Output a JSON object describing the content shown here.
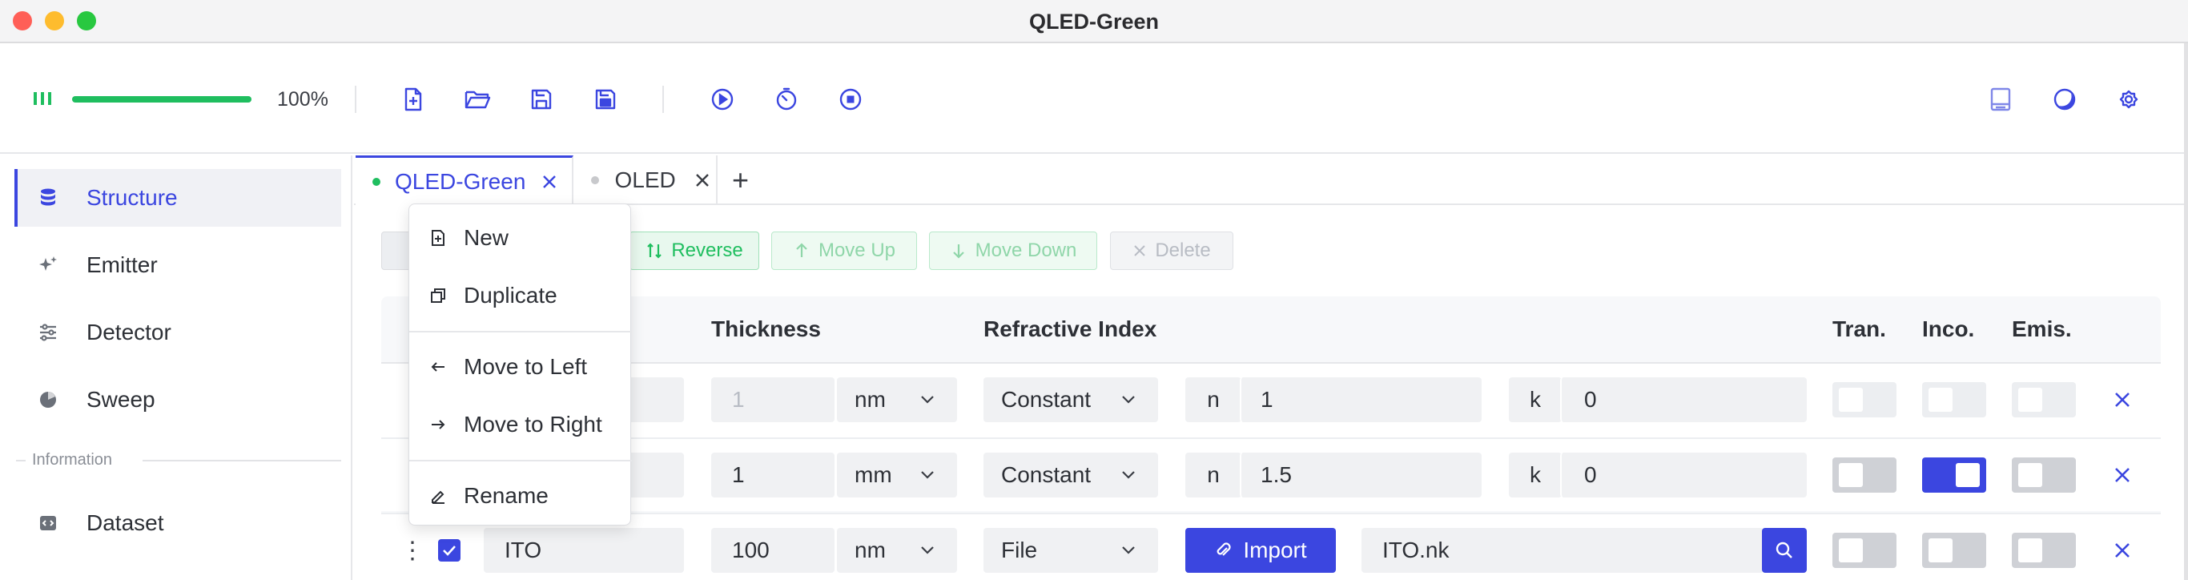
{
  "window": {
    "title": "QLED-Green",
    "traffic_colors": [
      "#ff5f57",
      "#febc2e",
      "#28c840"
    ]
  },
  "toolbar": {
    "progress": 1.0,
    "progress_label": "100%",
    "accent": "#3b46e0",
    "progress_color": "#1fbe5f",
    "icons": [
      "new-file-icon",
      "open-folder-icon",
      "save-icon",
      "save-as-icon",
      "run-icon",
      "timer-icon",
      "stop-icon",
      "book-icon",
      "theme-icon",
      "settings-icon"
    ]
  },
  "sidebar": {
    "items": [
      {
        "label": "Structure",
        "icon": "database-icon",
        "active": true
      },
      {
        "label": "Emitter",
        "icon": "sparkle-icon",
        "active": false
      },
      {
        "label": "Detector",
        "icon": "sliders-icon",
        "active": false
      },
      {
        "label": "Sweep",
        "icon": "sweep-icon",
        "active": false
      }
    ],
    "section_label": "Information",
    "info_items": [
      {
        "label": "Dataset",
        "icon": "code-file-icon"
      }
    ]
  },
  "tabs": {
    "items": [
      {
        "label": "QLED-Green",
        "active": true,
        "status_color": "#1fbe5f"
      },
      {
        "label": "OLED",
        "active": false,
        "status_color": "#c8c9cc"
      }
    ],
    "add_label": "+"
  },
  "actions": {
    "reverse": "Reverse",
    "move_up": "Move Up",
    "move_down": "Move Down",
    "delete": "Delete"
  },
  "table": {
    "headers": {
      "thickness": "Thickness",
      "refractive_index": "Refractive Index",
      "tran": "Tran.",
      "inco": "Inco.",
      "emis": "Emis."
    },
    "rows": [
      {
        "name": "",
        "thickness": "1",
        "unit": "nm",
        "ri_type": "Constant",
        "n_label": "n",
        "n": "1",
        "k_label": "k",
        "k": "0",
        "tran": false,
        "inco": false,
        "emis": false,
        "disabled": true
      },
      {
        "name": "",
        "thickness": "1",
        "unit": "mm",
        "ri_type": "Constant",
        "n_label": "n",
        "n": "1.5",
        "k_label": "k",
        "k": "0",
        "tran": false,
        "inco": true,
        "emis": false,
        "disabled": false
      },
      {
        "name": "ITO",
        "thickness": "100",
        "unit": "nm",
        "ri_type": "File",
        "import_label": "Import",
        "file": "ITO.nk",
        "tran": false,
        "inco": false,
        "emis": false,
        "checked": true
      }
    ]
  },
  "context_menu": {
    "items": [
      {
        "label": "New",
        "icon": "new-tab-icon"
      },
      {
        "label": "Duplicate",
        "icon": "duplicate-icon"
      },
      {
        "label": "Move to Left",
        "icon": "arrow-left-icon"
      },
      {
        "label": "Move to Right",
        "icon": "arrow-right-icon"
      },
      {
        "label": "Rename",
        "icon": "rename-icon"
      }
    ]
  }
}
